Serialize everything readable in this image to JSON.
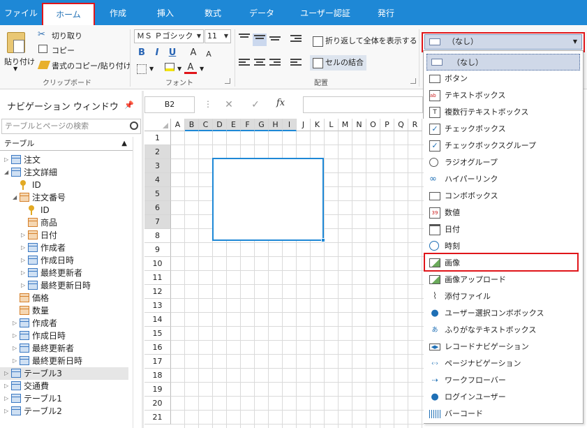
{
  "tabs": [
    {
      "id": "file",
      "label": "ファイル"
    },
    {
      "id": "home",
      "label": "ホーム"
    },
    {
      "id": "create",
      "label": "作成"
    },
    {
      "id": "insert",
      "label": "挿入"
    },
    {
      "id": "formula",
      "label": "数式"
    },
    {
      "id": "data",
      "label": "データ"
    },
    {
      "id": "userauth",
      "label": "ユーザー認証"
    },
    {
      "id": "publish",
      "label": "発行"
    }
  ],
  "clipboard": {
    "paste_label": "貼り付け",
    "cut_label": "切り取り",
    "copy_label": "コピー",
    "format_copy_label": "書式のコピー/貼り付け",
    "group_label": "クリップボード"
  },
  "font": {
    "family": "ＭＳ Ｐゴシック",
    "size": "11",
    "bold": "B",
    "italic": "I",
    "underline": "U",
    "grow": "A",
    "shrink": "A",
    "font_color_glyph": "A",
    "group_label": "フォント"
  },
  "alignment": {
    "wrap_label": "折り返して全体を表示する",
    "merge_label": "セルの結合",
    "group_label": "配置"
  },
  "celltype": {
    "selected": "（なし）",
    "options": [
      {
        "label": "（なし）",
        "icon": "none-icon"
      },
      {
        "label": "ボタン",
        "icon": "button-icon"
      },
      {
        "label": "テキストボックス",
        "icon": "textbox-icon"
      },
      {
        "label": "複数行テキストボックス",
        "icon": "multiline-textbox-icon"
      },
      {
        "label": "チェックボックス",
        "icon": "checkbox-icon"
      },
      {
        "label": "チェックボックスグループ",
        "icon": "checkbox-group-icon"
      },
      {
        "label": "ラジオグループ",
        "icon": "radio-group-icon"
      },
      {
        "label": "ハイパーリンク",
        "icon": "hyperlink-icon"
      },
      {
        "label": "コンボボックス",
        "icon": "combobox-icon"
      },
      {
        "label": "数値",
        "icon": "number-icon"
      },
      {
        "label": "日付",
        "icon": "date-icon"
      },
      {
        "label": "時刻",
        "icon": "time-icon"
      },
      {
        "label": "画像",
        "icon": "image-icon"
      },
      {
        "label": "画像アップロード",
        "icon": "image-upload-icon"
      },
      {
        "label": "添付ファイル",
        "icon": "attachment-icon"
      },
      {
        "label": "ユーザー選択コンボボックス",
        "icon": "user-select-icon"
      },
      {
        "label": "ふりがなテキストボックス",
        "icon": "furigana-icon"
      },
      {
        "label": "レコードナビゲーション",
        "icon": "record-nav-icon"
      },
      {
        "label": "ページナビゲーション",
        "icon": "page-nav-icon"
      },
      {
        "label": "ワークフローバー",
        "icon": "workflow-icon"
      },
      {
        "label": "ログインユーザー",
        "icon": "login-user-icon"
      },
      {
        "label": "バーコード",
        "icon": "barcode-icon"
      }
    ]
  },
  "nav": {
    "title": "ナビゲーション ウィンドウ",
    "search_placeholder": "テーブルとページの検索",
    "section": "テーブル",
    "tree": [
      {
        "label": "注文",
        "level": 0,
        "type": "table",
        "twisty": "closed"
      },
      {
        "label": "注文詳細",
        "level": 0,
        "type": "table",
        "twisty": "open"
      },
      {
        "label": "ID",
        "level": 1,
        "type": "key"
      },
      {
        "label": "注文番号",
        "level": 1,
        "type": "lookup",
        "twisty": "open"
      },
      {
        "label": "ID",
        "level": 2,
        "type": "key"
      },
      {
        "label": "商品",
        "level": 2,
        "type": "field-orange"
      },
      {
        "label": "日付",
        "level": 2,
        "type": "field-orange",
        "twisty": "closed"
      },
      {
        "label": "作成者",
        "level": 2,
        "type": "field",
        "twisty": "closed"
      },
      {
        "label": "作成日時",
        "level": 2,
        "type": "field",
        "twisty": "closed"
      },
      {
        "label": "最終更新者",
        "level": 2,
        "type": "field",
        "twisty": "closed"
      },
      {
        "label": "最終更新日時",
        "level": 2,
        "type": "field",
        "twisty": "closed"
      },
      {
        "label": "価格",
        "level": 1,
        "type": "field-orange"
      },
      {
        "label": "数量",
        "level": 1,
        "type": "field-orange"
      },
      {
        "label": "作成者",
        "level": 1,
        "type": "field",
        "twisty": "closed"
      },
      {
        "label": "作成日時",
        "level": 1,
        "type": "field",
        "twisty": "closed"
      },
      {
        "label": "最終更新者",
        "level": 1,
        "type": "field",
        "twisty": "closed"
      },
      {
        "label": "最終更新日時",
        "level": 1,
        "type": "field",
        "twisty": "closed"
      },
      {
        "label": "テーブル3",
        "level": 0,
        "type": "table",
        "twisty": "closed",
        "highlight": true
      },
      {
        "label": "交通費",
        "level": 0,
        "type": "table",
        "twisty": "closed"
      },
      {
        "label": "テーブル1",
        "level": 0,
        "type": "table",
        "twisty": "closed"
      },
      {
        "label": "テーブル2",
        "level": 0,
        "type": "table",
        "twisty": "closed"
      }
    ]
  },
  "formula_bar": {
    "cell_ref": "B2",
    "cancel": "✕",
    "confirm": "✓",
    "fx": "fx",
    "value": ""
  },
  "grid": {
    "columns": [
      "A",
      "B",
      "C",
      "D",
      "E",
      "F",
      "G",
      "H",
      "I",
      "J",
      "K",
      "L",
      "M",
      "N",
      "O",
      "P",
      "Q",
      "R"
    ],
    "rows": [
      "1",
      "2",
      "3",
      "4",
      "5",
      "6",
      "7",
      "8",
      "9",
      "10",
      "11",
      "12",
      "13",
      "14",
      "15",
      "16",
      "17",
      "18",
      "19",
      "20",
      "21"
    ],
    "selected_cols": [
      "B",
      "C",
      "D",
      "E",
      "F",
      "G",
      "H",
      "I"
    ],
    "selected_rows": [
      "2",
      "3",
      "4",
      "5",
      "6",
      "7"
    ]
  },
  "colors": {
    "accent": "#1e88d6",
    "highlight_red": "#e0151a",
    "selection_fill": "#cfd8e8"
  }
}
